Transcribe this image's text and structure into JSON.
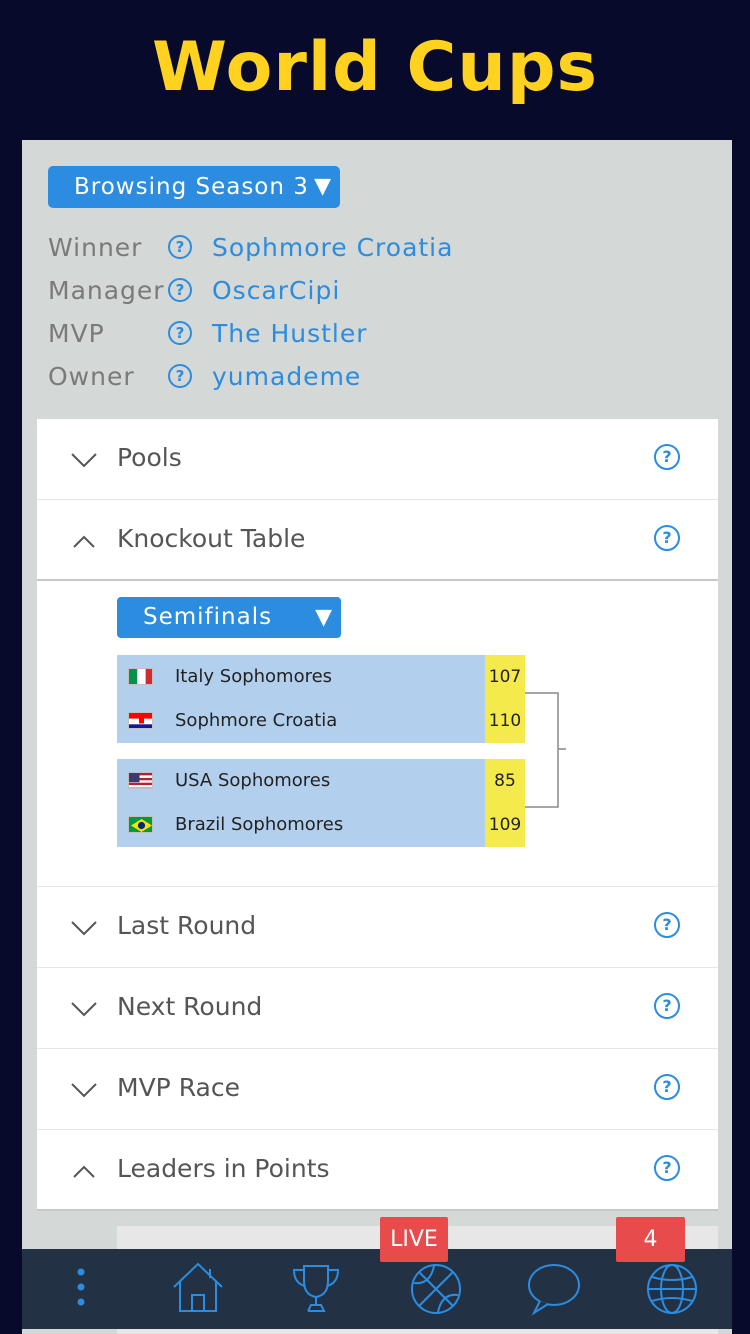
{
  "app_title": "World Cups",
  "season_selector": {
    "label": "Browsing Season 3",
    "caret": "▼"
  },
  "season_info": [
    {
      "label": "Winner",
      "help": "?",
      "value": "Sophmore Croatia"
    },
    {
      "label": "Manager",
      "help": "?",
      "value": "OscarCipi"
    },
    {
      "label": "MVP",
      "help": "?",
      "value": "The Hustler"
    },
    {
      "label": "Owner",
      "help": "?",
      "value": "yumademe"
    }
  ],
  "sections": {
    "pools": {
      "label": "Pools",
      "expanded": false,
      "help": "?"
    },
    "knockout": {
      "label": "Knockout Table",
      "expanded": true,
      "help": "?"
    },
    "last_round": {
      "label": "Last Round",
      "expanded": false,
      "help": "?"
    },
    "next_round": {
      "label": "Next Round",
      "expanded": false,
      "help": "?"
    },
    "mvp_race": {
      "label": "MVP Race",
      "expanded": false,
      "help": "?"
    },
    "leaders_points": {
      "label": "Leaders in Points",
      "expanded": true,
      "help": "?"
    }
  },
  "knockout": {
    "round_selector": {
      "label": "Semifinals",
      "caret": "▼"
    },
    "matches": [
      {
        "teams": [
          {
            "flag": "italy-flag",
            "name": "Italy Sophomores",
            "score": "107"
          },
          {
            "flag": "croatia-flag",
            "name": "Sophmore Croatia",
            "score": "110"
          }
        ]
      },
      {
        "teams": [
          {
            "flag": "usa-flag",
            "name": "USA Sophomores",
            "score": "85"
          },
          {
            "flag": "brazil-flag",
            "name": "Brazil Sophomores",
            "score": "109"
          }
        ]
      }
    ]
  },
  "tab_bar": {
    "items": [
      "more-icon",
      "home-icon",
      "trophy-icon",
      "basketball-icon",
      "chat-icon",
      "globe-icon"
    ],
    "live_badge": "LIVE",
    "notification_count": "4"
  },
  "colors": {
    "background": "#070a2a",
    "title": "#ffd21f",
    "accent": "#2b8ce0",
    "panel": "#d4d8d6",
    "match_bg": "#b2d0ee",
    "score_bg": "#f4ea4c",
    "tabbar": "#233145",
    "badge": "#e84b4b"
  }
}
